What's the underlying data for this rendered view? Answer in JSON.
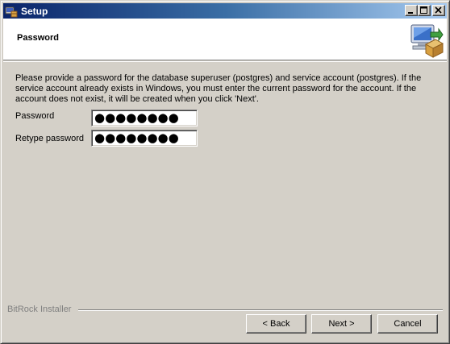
{
  "window": {
    "title": "Setup",
    "controls": {
      "minimize": "minimize-icon",
      "maximize": "maximize-icon",
      "close": "close-icon"
    }
  },
  "header": {
    "title": "Password",
    "icon": "installer-computer-box-icon"
  },
  "content": {
    "description": "Please provide a password for the database superuser (postgres) and service account (postgres). If the service account already exists in Windows, you must enter the current password for the account. If the account does not exist, it will be created when you click 'Next'.",
    "password": {
      "label": "Password",
      "value": "●●●●●●●●"
    },
    "retype_password": {
      "label": "Retype password",
      "value": "●●●●●●●●"
    }
  },
  "footer": {
    "brand": "BitRock Installer",
    "buttons": {
      "back": "< Back",
      "next": "Next >",
      "cancel": "Cancel"
    }
  },
  "colors": {
    "titlebar_start": "#0a246a",
    "titlebar_end": "#a6caf0",
    "dialog_face": "#d4d0c8"
  }
}
